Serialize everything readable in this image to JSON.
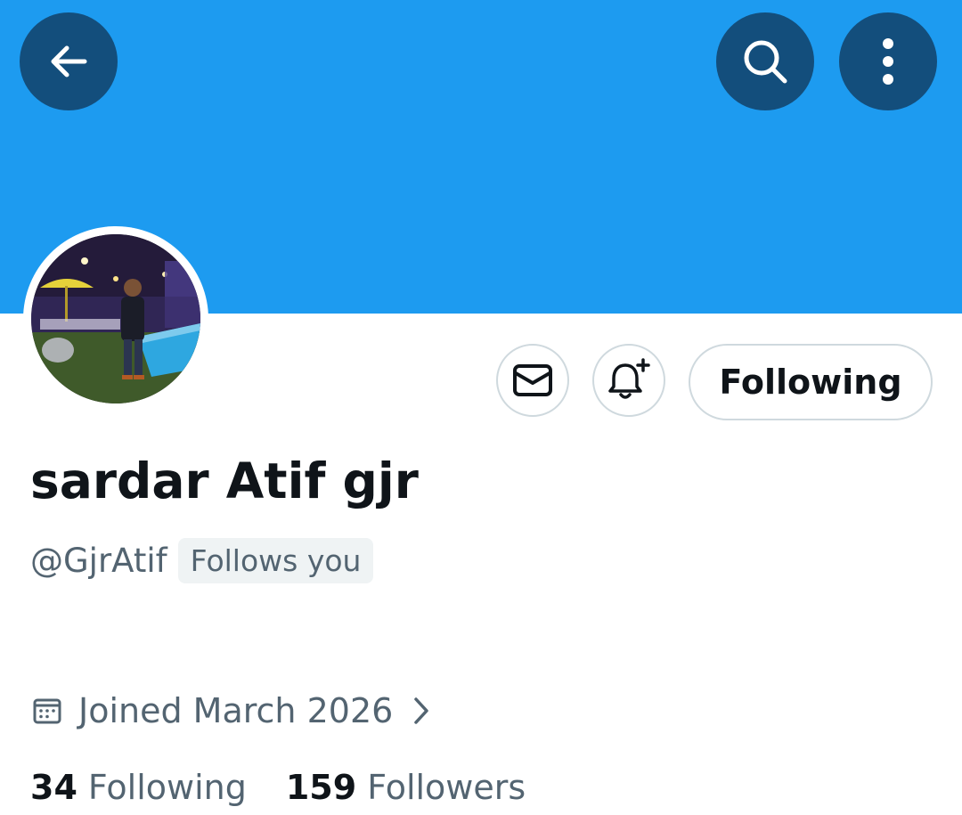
{
  "header": {
    "back_icon": "arrow-left-icon",
    "search_icon": "search-icon",
    "more_icon": "more-vertical-icon",
    "banner_color": "#1d9bf0",
    "button_bg": "#134e7c"
  },
  "profile": {
    "display_name": "sardar Atif gjr",
    "handle": "@GjrAtif",
    "follows_you_label": "Follows you",
    "joined": "Joined March 2026",
    "following_count": "34",
    "following_label": "Following",
    "followers_count": "159",
    "followers_label": "Followers"
  },
  "actions": {
    "message_icon": "envelope-icon",
    "notify_icon": "bell-plus-icon",
    "follow_button_label": "Following"
  },
  "colors": {
    "text_primary": "#0f1419",
    "text_secondary": "#536471",
    "border": "#cfd9de"
  }
}
